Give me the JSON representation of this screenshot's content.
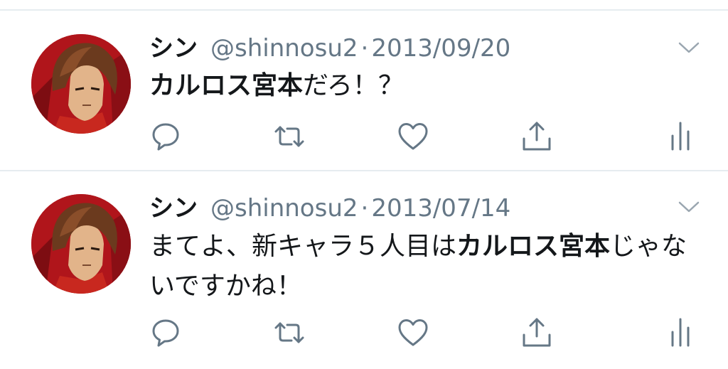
{
  "tweets": [
    {
      "display_name": "シン",
      "handle": "@shinnosu2",
      "separator": "·",
      "date": "2013/09/20",
      "text_bold_1": "カルロス宮本",
      "text_plain_1": "だろ！？",
      "text_plain_0": "",
      "text_bold_2": "",
      "text_plain_2": ""
    },
    {
      "display_name": "シン",
      "handle": "@shinnosu2",
      "separator": "·",
      "date": "2013/07/14",
      "text_plain_0": "まてよ、新キャラ５人目は",
      "text_bold_1": "カルロス宮本",
      "text_plain_1": "じゃないですかね！",
      "text_bold_2": "",
      "text_plain_2": ""
    }
  ],
  "icons": {
    "avatar": "avatar",
    "menu": "chevron-down-icon",
    "reply": "reply-icon",
    "retweet": "retweet-icon",
    "like": "heart-icon",
    "share": "share-icon",
    "analytics": "analytics-icon"
  },
  "colors": {
    "text": "#14171a",
    "muted": "#657786",
    "icon": "#657786",
    "divider": "#e6ecf0",
    "avatar_bg": "#b0151b"
  }
}
